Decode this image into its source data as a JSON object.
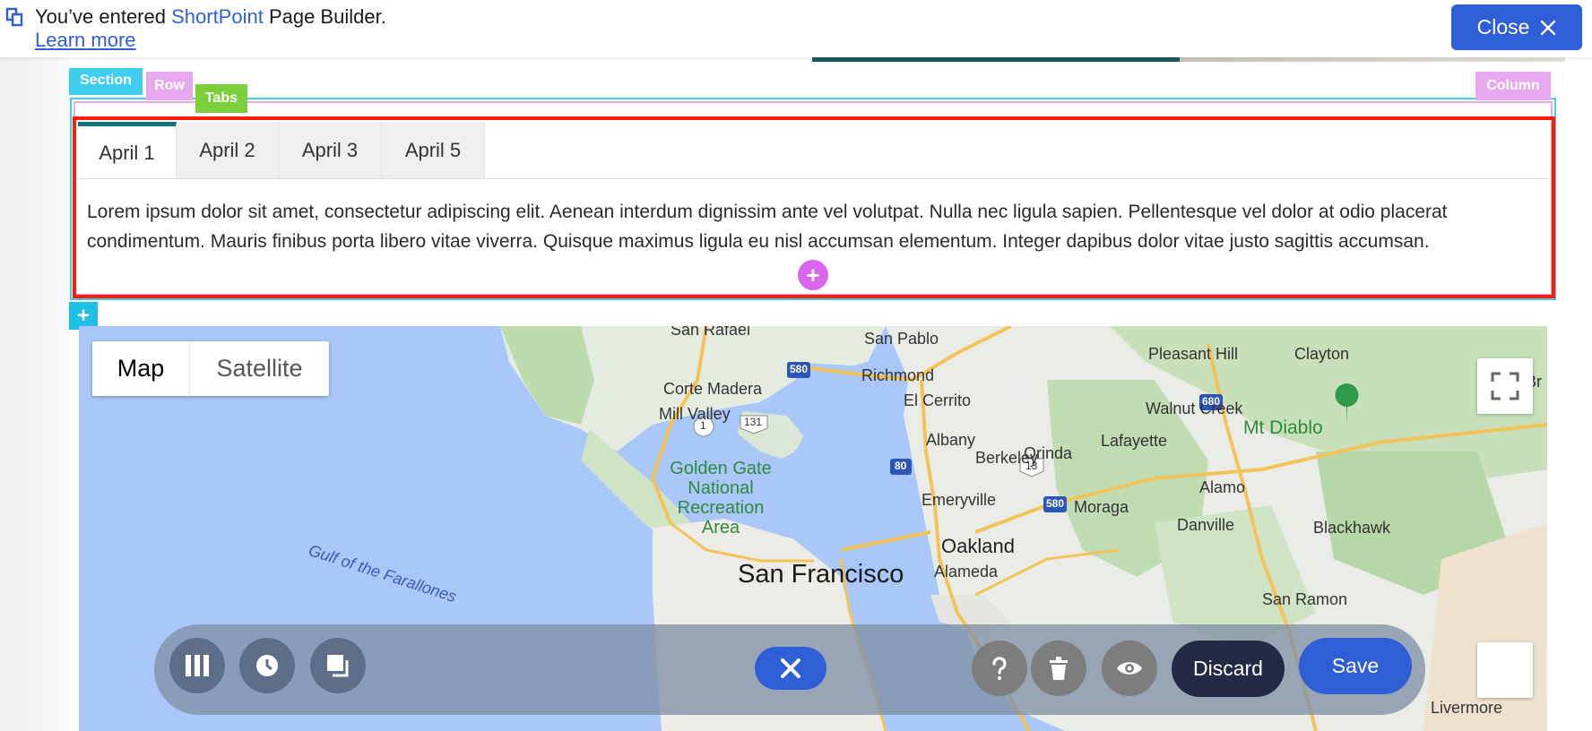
{
  "banner": {
    "message_prefix": "You’ve entered ",
    "brand": "ShortPoint",
    "message_suffix": " Page Builder.",
    "learn_more": "Learn more",
    "close_label": "Close",
    "logo_icon": "shortpoint-logo-icon"
  },
  "builder": {
    "section_label": "Section",
    "row_label": "Row",
    "tabs_label": "Tabs",
    "column_label": "Column",
    "add_element_icon": "plus-icon",
    "add_section_icon": "plus-icon"
  },
  "tabs": {
    "items": [
      {
        "label": "April 1",
        "active": true
      },
      {
        "label": "April 2",
        "active": false
      },
      {
        "label": "April 3",
        "active": false
      },
      {
        "label": "April 5",
        "active": false
      }
    ],
    "content": "Lorem ipsum dolor sit amet, consectetur adipiscing elit. Aenean interdum dignissim ante vel volutpat. Nulla nec ligula sapien. Pellentesque vel dolor at odio placerat condimentum. Mauris finibus porta libero vitae viverra. Quisque maximus ligula eu nisl accumsan elementum. Integer dapibus dolor vitae justo sagittis accumsan."
  },
  "map": {
    "type_map": "Map",
    "type_satellite": "Satellite",
    "selected_type": "Map",
    "labels": {
      "san_rafael": "San Rafael",
      "san_pablo": "San Pablo",
      "pleasant_hill": "Pleasant Hill",
      "clayton": "Clayton",
      "br": "Br",
      "richmond": "Richmond",
      "corte_madera": "Corte Madera",
      "el_cerrito": "El Cerrito",
      "mill_valley": "Mill Valley",
      "walnut_creek": "Walnut Creek",
      "mt_diablo": "Mt Diablo",
      "albany": "Albany",
      "orinda": "Orinda",
      "lafayette": "Lafayette",
      "berkeley": "Berkeley",
      "golden_gate": "Golden Gate National Recreation Area",
      "emeryville": "Emeryville",
      "moraga": "Moraga",
      "alamo": "Alamo",
      "danville": "Danville",
      "blackhawk": "Blackhawk",
      "gulf": "Gulf of the Farallones",
      "oakland": "Oakland",
      "alameda": "Alameda",
      "san_francisco": "San Francisco",
      "san_ramon": "San Ramon",
      "livermore": "Livermore",
      "shield_580a": "580",
      "shield_131": "131",
      "shield_1": "1",
      "shield_80": "80",
      "shield_13": "13",
      "shield_580b": "580",
      "shield_680a": "680",
      "shield_680b": "680"
    }
  },
  "toolbar": {
    "columns_icon": "columns-icon",
    "history_icon": "clock-icon",
    "layers_icon": "copy-icon",
    "close_icon": "close-icon",
    "help_icon": "question-icon",
    "trash_icon": "trash-icon",
    "preview_icon": "eye-icon",
    "discard_label": "Discard",
    "save_label": "Save"
  },
  "colors": {
    "brand_blue": "#2f5fd6",
    "section_cyan": "#3ecff0",
    "row_pink": "#e8a8ee",
    "tabs_green": "#7ccf3a",
    "selection_red": "#ff1a00",
    "active_tab_teal": "#137078",
    "discard_navy": "#232a45"
  }
}
